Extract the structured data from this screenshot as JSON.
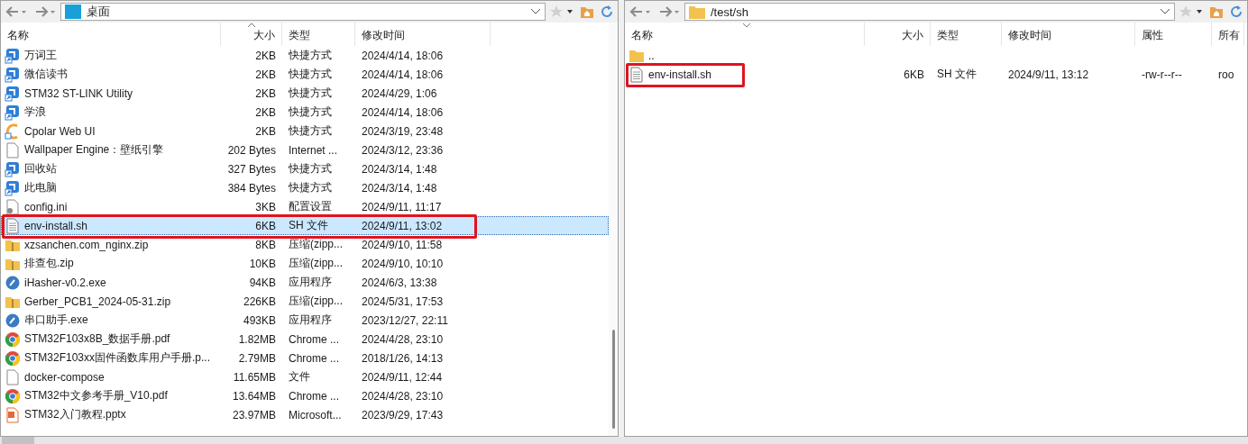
{
  "panes": [
    {
      "kind": "local",
      "path": "桌面",
      "columns": [
        {
          "label": "名称"
        },
        {
          "label": "大小",
          "sort_ascending": true
        },
        {
          "label": "类型"
        },
        {
          "label": "修改时间"
        }
      ],
      "rows": [
        {
          "kind": "shortcut",
          "cells": [
            "万词王",
            "2KB",
            "快捷方式",
            "2024/4/14, 18:06"
          ],
          "selected": false
        },
        {
          "kind": "shortcut",
          "cells": [
            "微信读书",
            "2KB",
            "快捷方式",
            "2024/4/14, 18:06"
          ],
          "selected": false
        },
        {
          "kind": "shortcut",
          "cells": [
            "STM32 ST-LINK Utility",
            "2KB",
            "快捷方式",
            "2024/4/29, 1:06"
          ],
          "selected": false
        },
        {
          "kind": "shortcut",
          "cells": [
            "学浪",
            "2KB",
            "快捷方式",
            "2024/4/14, 18:06"
          ],
          "selected": false
        },
        {
          "kind": "web",
          "cells": [
            "Cpolar Web UI",
            "2KB",
            "快捷方式",
            "2024/3/19, 23:48"
          ],
          "selected": false
        },
        {
          "kind": "file",
          "cells": [
            "Wallpaper Engine：壁纸引擎",
            "202 Bytes",
            "Internet ...",
            "2024/3/12, 23:36"
          ],
          "selected": false
        },
        {
          "kind": "shortcut",
          "cells": [
            "回收站",
            "327 Bytes",
            "快捷方式",
            "2024/3/14, 1:48"
          ],
          "selected": false
        },
        {
          "kind": "shortcut",
          "cells": [
            "此电脑",
            "384 Bytes",
            "快捷方式",
            "2024/3/14, 1:48"
          ],
          "selected": false
        },
        {
          "kind": "ini",
          "cells": [
            "config.ini",
            "3KB",
            "配置设置",
            "2024/9/11, 11:17"
          ],
          "selected": false
        },
        {
          "kind": "text",
          "cells": [
            "env-install.sh",
            "6KB",
            "SH 文件",
            "2024/9/11, 13:02"
          ],
          "selected": true,
          "annotated": true
        },
        {
          "kind": "zip",
          "cells": [
            "xzsanchen.com_nginx.zip",
            "8KB",
            "压缩(zipp...",
            "2024/9/10, 11:58"
          ],
          "selected": false
        },
        {
          "kind": "zip",
          "cells": [
            "排查包.zip",
            "10KB",
            "压缩(zipp...",
            "2024/9/10, 10:10"
          ],
          "selected": false
        },
        {
          "kind": "exe",
          "cells": [
            "iHasher-v0.2.exe",
            "94KB",
            "应用程序",
            "2024/6/3, 13:38"
          ],
          "selected": false
        },
        {
          "kind": "zip",
          "cells": [
            "Gerber_PCB1_2024-05-31.zip",
            "226KB",
            "压缩(zipp...",
            "2024/5/31, 17:53"
          ],
          "selected": false
        },
        {
          "kind": "exe",
          "cells": [
            "串口助手.exe",
            "493KB",
            "应用程序",
            "2023/12/27, 22:11"
          ],
          "selected": false
        },
        {
          "kind": "chrome",
          "cells": [
            "STM32F103x8B_数据手册.pdf",
            "1.82MB",
            "Chrome ...",
            "2024/4/28, 23:10"
          ],
          "selected": false
        },
        {
          "kind": "chrome",
          "cells": [
            "STM32F103xx固件函数库用户手册.p...",
            "2.79MB",
            "Chrome ...",
            "2018/1/26, 14:13"
          ],
          "selected": false
        },
        {
          "kind": "file",
          "cells": [
            "docker-compose",
            "11.65MB",
            "文件",
            "2024/9/11, 12:44"
          ],
          "selected": false
        },
        {
          "kind": "chrome",
          "cells": [
            "STM32中文参考手册_V10.pdf",
            "13.64MB",
            "Chrome ...",
            "2024/4/28, 23:10"
          ],
          "selected": false
        },
        {
          "kind": "pptx",
          "cells": [
            "STM32入门教程.pptx",
            "23.97MB",
            "Microsoft...",
            "2023/9/29, 17:43"
          ],
          "selected": false
        }
      ]
    },
    {
      "kind": "remote",
      "path": "/test/sh",
      "columns": [
        {
          "label": "名称",
          "sort_descending": true
        },
        {
          "label": "大小"
        },
        {
          "label": "类型"
        },
        {
          "label": "修改时间"
        },
        {
          "label": "属性"
        },
        {
          "label": "所有"
        }
      ],
      "rows": [
        {
          "kind": "folder",
          "cells": [
            ".."
          ],
          "selected": false
        },
        {
          "kind": "text",
          "cells": [
            "env-install.sh",
            "6KB",
            "SH 文件",
            "2024/9/11, 13:12",
            "-rw-r--r--",
            "roo"
          ],
          "selected": false,
          "annotated": true
        }
      ]
    }
  ]
}
